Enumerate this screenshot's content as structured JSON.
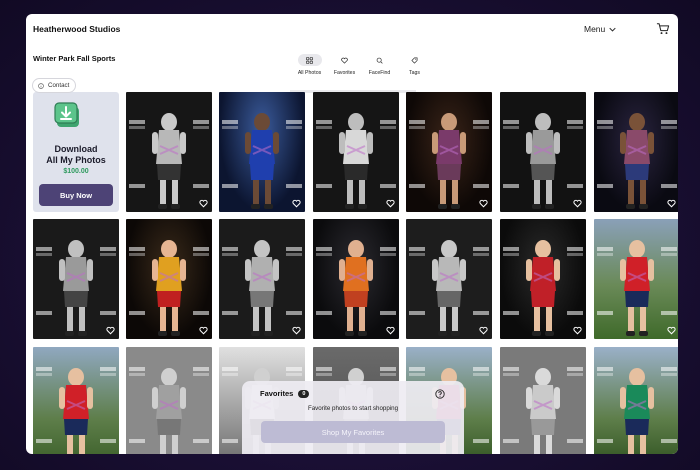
{
  "header": {
    "brand": "Heatherwood Studios",
    "menu_label": "Menu"
  },
  "gallery": {
    "title": "Winter Park Fall Sports"
  },
  "tabs": [
    {
      "label": "All Photos",
      "icon": "grid-icon",
      "active": true
    },
    {
      "label": "Favorites",
      "icon": "heart-icon",
      "active": false
    },
    {
      "label": "FaceFind",
      "icon": "face-scan-icon",
      "active": false
    },
    {
      "label": "Tags",
      "icon": "tag-icon",
      "active": false
    }
  ],
  "contact": {
    "label": "Contact"
  },
  "promo": {
    "title_line1": "Download",
    "title_line2": "All My Photos",
    "price": "$100.00",
    "button_label": "Buy Now"
  },
  "favorites_panel": {
    "title": "Favorites",
    "count": "0",
    "message": "Favorite photos to start shopping",
    "button_label": "Shop My Favorites"
  },
  "colors": {
    "accent": "#4d4376",
    "price_green": "#2e9a5e",
    "page_bg": "#1a0f34"
  }
}
